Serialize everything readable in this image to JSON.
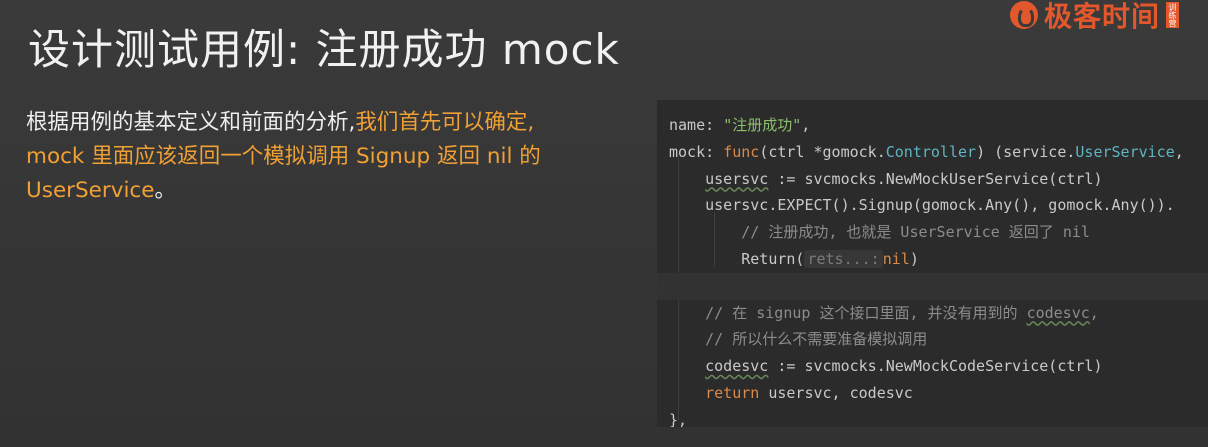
{
  "title": "设计测试用例: 注册成功 mock",
  "logo": {
    "text": "极客时间",
    "sub": "训练营"
  },
  "description": {
    "normal": "根据用例的基本定义和前面的分析,",
    "highlight_1": "我们首先可以确定,",
    "highlight_2": "mock 里面应该返回一个模拟调用 Signup 返回 nil 的",
    "highlight_3": "UserService",
    "end": "。"
  },
  "code": {
    "l1_key": "name: ",
    "l1_str": "\"注册成功\"",
    "l1_end": ",",
    "l2_a": "mock: ",
    "l2_kw": "func",
    "l2_b": "(ctrl *gomock.",
    "l2_typ": "Controller",
    "l2_c": ") (service.",
    "l2_typ2": "UserService",
    "l2_d": ",",
    "l3_var": "usersvc",
    "l3_b": " := svcmocks.NewMockUserService(ctrl)",
    "l4": "usersvc.EXPECT().Signup(gomock.Any(), gomock.Any()).",
    "l5": "// 注册成功, 也就是 UserService 返回了 nil",
    "l6_a": "Return(",
    "l6_hint": "rets...:",
    "l6_kw": "nil",
    "l6_b": ")",
    "l8": "// 在 signup 这个接口里面, 并没有用到的 ",
    "l8_var": "codesvc",
    "l8_end": ",",
    "l9": "// 所以什么不需要准备模拟调用",
    "l10_var": "codesvc",
    "l10_b": " := svcmocks.NewMockCodeService(ctrl)",
    "l11_kw": "return",
    "l11_b": " usersvc, codesvc",
    "l12": "},"
  }
}
